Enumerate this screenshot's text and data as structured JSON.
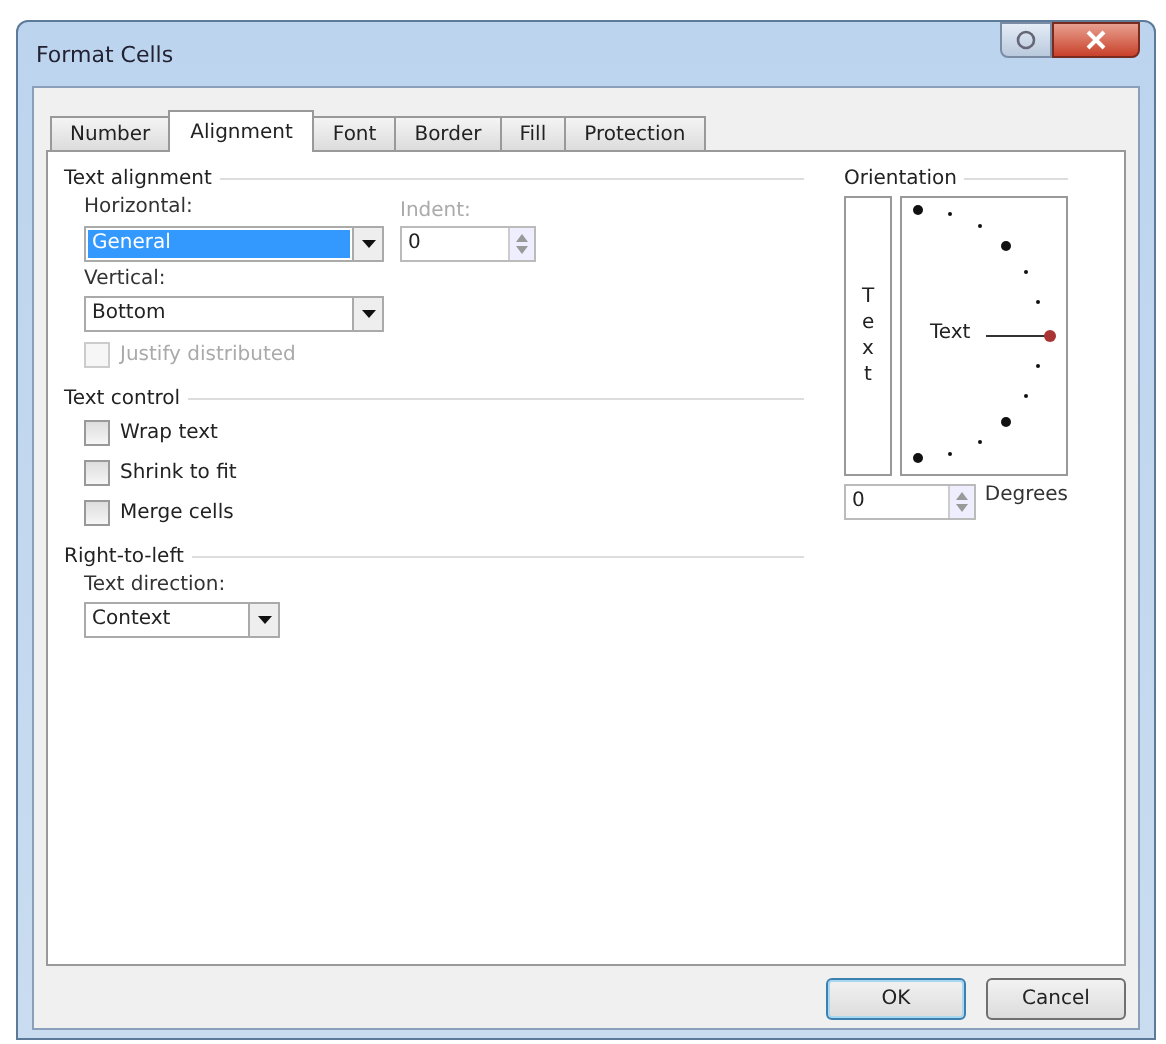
{
  "window": {
    "title": "Format Cells"
  },
  "tabs": [
    {
      "label": "Number",
      "selected": false
    },
    {
      "label": "Alignment",
      "selected": true
    },
    {
      "label": "Font",
      "selected": false
    },
    {
      "label": "Border",
      "selected": false
    },
    {
      "label": "Fill",
      "selected": false
    },
    {
      "label": "Protection",
      "selected": false
    }
  ],
  "text_alignment": {
    "heading": "Text alignment",
    "horizontal": {
      "label": "Horizontal:",
      "value": "General",
      "selected": true
    },
    "indent": {
      "label": "Indent:",
      "value": "0",
      "disabled": true
    },
    "vertical": {
      "label": "Vertical:",
      "value": "Bottom",
      "selected": false
    },
    "justify_distributed": {
      "label": "Justify distributed",
      "checked": false,
      "disabled": true
    }
  },
  "text_control": {
    "heading": "Text control",
    "options": [
      {
        "label": "Wrap text",
        "checked": false,
        "disabled": false
      },
      {
        "label": "Shrink to fit",
        "checked": false,
        "disabled": false
      },
      {
        "label": "Merge cells",
        "checked": false,
        "disabled": false
      }
    ]
  },
  "right_to_left": {
    "heading": "Right-to-left",
    "text_direction": {
      "label": "Text direction:",
      "value": "Context"
    }
  },
  "orientation": {
    "heading": "Orientation",
    "vertical_text": "Text",
    "dial_text": "Text",
    "degrees": {
      "value": "0",
      "label": "Degrees"
    }
  },
  "buttons": [
    "OK",
    "Cancel"
  ]
}
